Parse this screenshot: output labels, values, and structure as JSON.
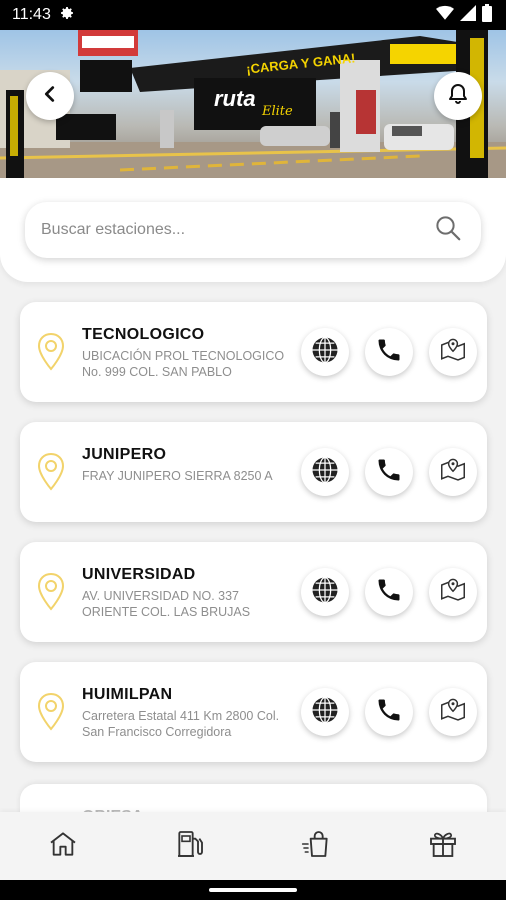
{
  "status_bar": {
    "time": "11:43"
  },
  "hero": {
    "brand_text": "ruta",
    "brand_script": "Elite",
    "promo_text": "¡CARGA Y GANA!"
  },
  "search": {
    "placeholder": "Buscar estaciones..."
  },
  "stations": [
    {
      "name": "TECNOLOGICO",
      "address": "UBICACIÓN PROL TECNOLOGICO No. 999 COL. SAN PABLO"
    },
    {
      "name": "JUNIPERO",
      "address": "FRAY JUNIPERO SIERRA 8250 A"
    },
    {
      "name": "UNIVERSIDAD",
      "address": "AV. UNIVERSIDAD NO. 337 ORIENTE COL. LAS BRUJAS"
    },
    {
      "name": "HUIMILPAN",
      "address": "Carretera Estatal 411 Km 2800 Col. San Francisco Corregidora"
    }
  ],
  "partial_station": {
    "name": "OBIESA"
  },
  "colors": {
    "pin": "#f2d36b",
    "accent_yellow": "#f5d400",
    "text_dark": "#111111",
    "text_muted": "#8e8e8e"
  },
  "nav_icons": [
    "home-icon",
    "fuel-pump-icon",
    "shopping-bag-icon",
    "gift-icon"
  ]
}
